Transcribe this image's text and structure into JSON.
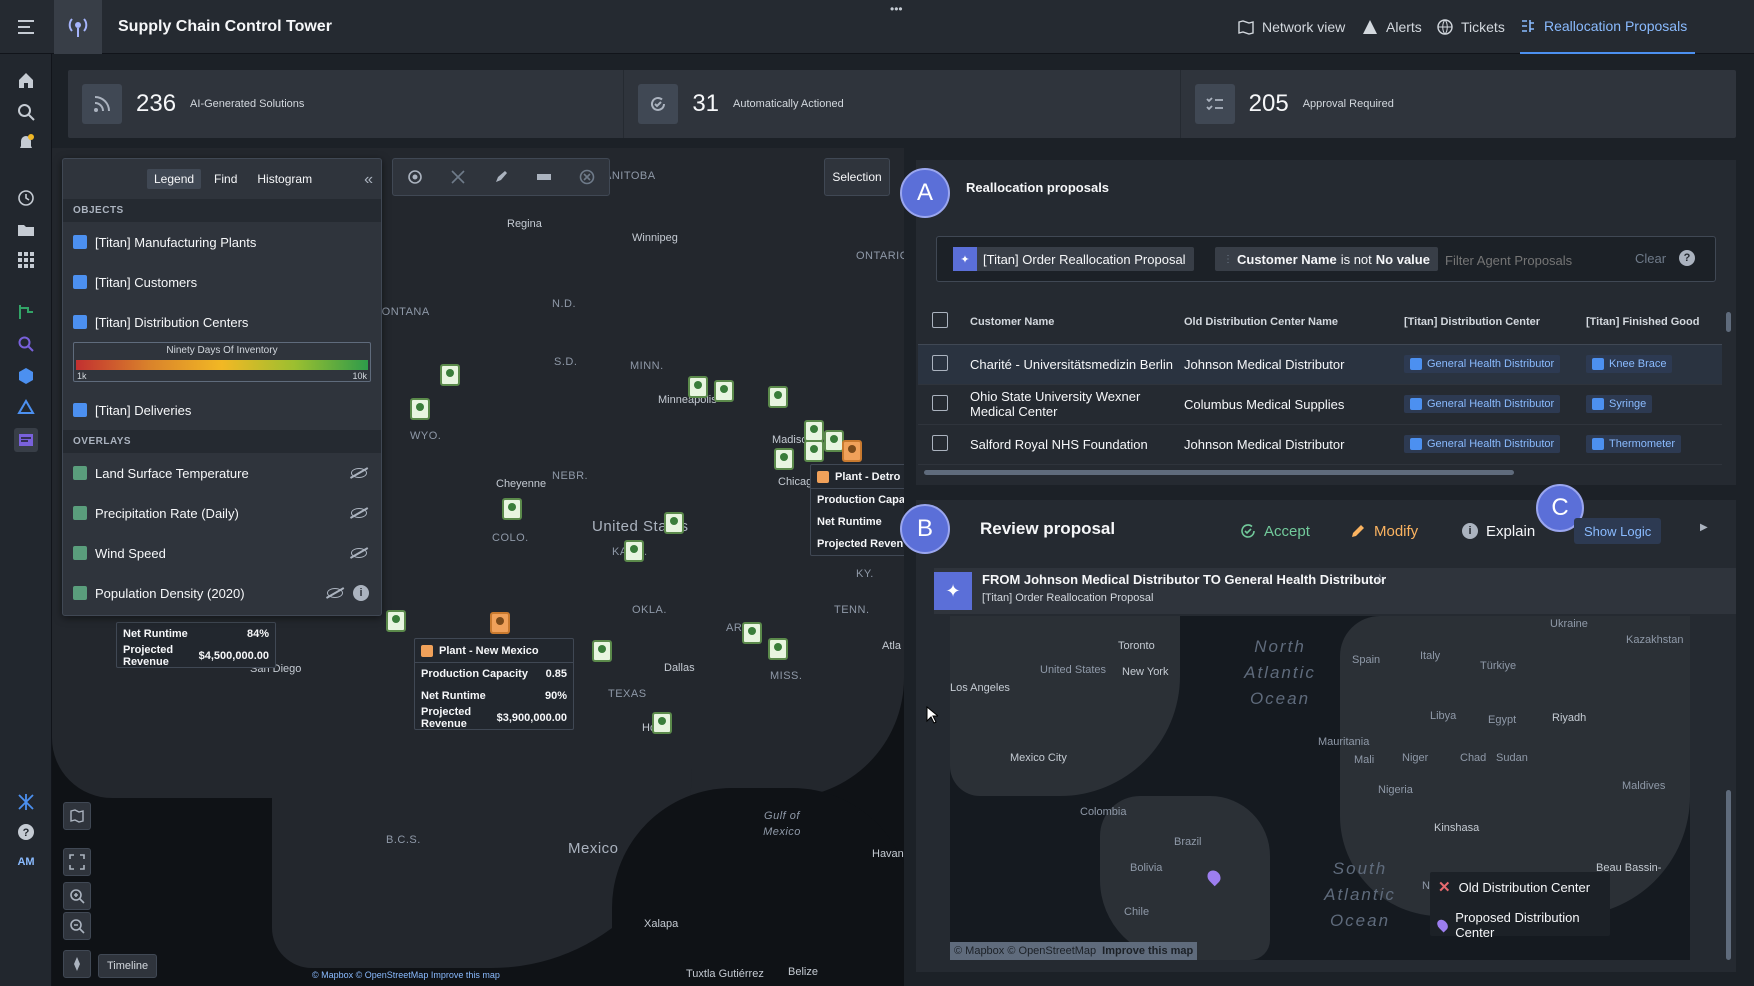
{
  "app": {
    "title": "Supply Chain Control Tower",
    "more": "•••"
  },
  "nav": {
    "tabs": [
      {
        "label": "Network view"
      },
      {
        "label": "Alerts"
      },
      {
        "label": "Tickets"
      },
      {
        "label": "Reallocation Proposals"
      }
    ]
  },
  "kpis": [
    {
      "value": "236",
      "label": "AI-Generated Solutions"
    },
    {
      "value": "31",
      "label": "Automatically Actioned"
    },
    {
      "value": "205",
      "label": "Approval Required"
    }
  ],
  "user": {
    "initials": "AM"
  },
  "legend": {
    "tabs": [
      "Legend",
      "Find",
      "Histogram"
    ],
    "objects_header": "OBJECTS",
    "objects": [
      "[Titan] Manufacturing Plants",
      "[Titan] Customers",
      "[Titan] Distribution Centers",
      "[Titan] Deliveries"
    ],
    "gradient": {
      "title": "Ninety Days Of Inventory",
      "min": "1k",
      "max": "10k"
    },
    "overlays_header": "OVERLAYS",
    "overlays": [
      "Land Surface Temperature",
      "Precipitation Rate (Daily)",
      "Wind Speed",
      "Population Density (2020)"
    ]
  },
  "map": {
    "selection_label": "Selection",
    "timeline_label": "Timeline",
    "attribution": "© Mapbox © OpenStreetMap Improve this map",
    "labels": {
      "manitoba": "ANITOBA",
      "ontario": "ONTARIO",
      "montana": "MONTANA",
      "nd": "N.D.",
      "sd": "S.D.",
      "minn": "MINN.",
      "wyo": "WYO.",
      "nebr": "NEBR.",
      "colo": "COLO.",
      "kans": "KANS.",
      "ky": "KY.",
      "tenn": "TENN.",
      "okla": "OKLA.",
      "ark": "ARK.",
      "miss": "MISS.",
      "texas": "TEXAS",
      "us": "United States",
      "mexico": "Mexico",
      "bcs": "B.C.S.",
      "gulf": "Gulf of Mexico"
    },
    "cities": {
      "regina": "Regina",
      "winnipeg": "Winnipeg",
      "minneapolis": "Minneapolis",
      "madison": "Madison",
      "chicago": "Chicag",
      "detroit": "Detro",
      "cheyenne": "Cheyenne",
      "dallas": "Dallas",
      "houston": "Houst",
      "sandiego": "San Diego",
      "atlanta": "Atla",
      "havana": "Havan",
      "xalapa": "Xalapa",
      "tuxtla": "Tuxtla Gutiérrez",
      "belize": "Belize"
    },
    "popups": {
      "new_mexico": {
        "title": "Plant - New Mexico",
        "rows": [
          {
            "k": "Production Capacity",
            "v": "0.85"
          },
          {
            "k": "Net Runtime",
            "v": "90%"
          },
          {
            "k": "Projected Revenue",
            "v": "$3,900,000.00"
          }
        ]
      },
      "detroit": {
        "title": "Plant - Detro",
        "rows": [
          {
            "k": "Production Capa",
            "v": ""
          },
          {
            "k": "Net Runtime",
            "v": ""
          },
          {
            "k": "Projected Reven",
            "v": ""
          }
        ]
      },
      "west": {
        "rows": [
          {
            "k": "Net Runtime",
            "v": "84%"
          },
          {
            "k": "Projected Revenue",
            "v": "$4,500,000.00"
          }
        ]
      }
    }
  },
  "proposals": {
    "badge": "A",
    "title": "Reallocation proposals",
    "filter_chip": "[Titan] Order Reallocation Proposal",
    "condition_chip": {
      "field": "Customer Name",
      "op": "is not",
      "value": "No value"
    },
    "search_placeholder": "Filter Agent Proposals",
    "clear_label": "Clear",
    "help": "?",
    "columns": [
      "Customer Name",
      "Old Distribution Center Name",
      "[Titan] Distribution Center",
      "[Titan] Finished Good"
    ],
    "rows": [
      {
        "customer": "Charité - Universitätsmedizin Berlin",
        "old_dc": "Johnson Medical Distributor",
        "new_dc": "General Health Distributor",
        "good": "Knee Brace"
      },
      {
        "customer": "Ohio State University Wexner Medical Center",
        "old_dc": "Columbus Medical Supplies",
        "new_dc": "General Health Distributor",
        "good": "Syringe"
      },
      {
        "customer": "Salford Royal NHS Foundation",
        "old_dc": "Johnson Medical Distributor",
        "new_dc": "General Health Distributor",
        "good": "Thermometer"
      }
    ]
  },
  "review": {
    "badge": "B",
    "badge_c": "C",
    "title": "Review proposal",
    "accept": "Accept",
    "modify": "Modify",
    "explain": "Explain",
    "show_logic": "Show Logic",
    "proposal_title": "FROM Johnson Medical Distributor TO General Health Distributor",
    "proposal_subtitle": "[Titan] Order Reallocation Proposal",
    "minimap": {
      "oceans": [
        "North Atlantic Ocean",
        "South Atlantic Ocean"
      ],
      "places": [
        "Toronto",
        "New York",
        "United States",
        "Los Angeles",
        "Mexico City",
        "Colombia",
        "Brazil",
        "Bolivia",
        "Chile",
        "Ukraine",
        "Kazakhstan",
        "Spain",
        "Italy",
        "Türkiye",
        "Libya",
        "Egypt",
        "Riyadh",
        "Mauritania",
        "Mali",
        "Niger",
        "Chad",
        "Sudan",
        "Nigeria",
        "Kinshasa",
        "Namibia",
        "Maldives",
        "Beau Bassin-"
      ],
      "legend_old": "Old Distribution Center",
      "legend_new": "Proposed Distribution Center",
      "attribution": "© Mapbox © OpenStreetMap",
      "improve": "Improve this map"
    }
  }
}
